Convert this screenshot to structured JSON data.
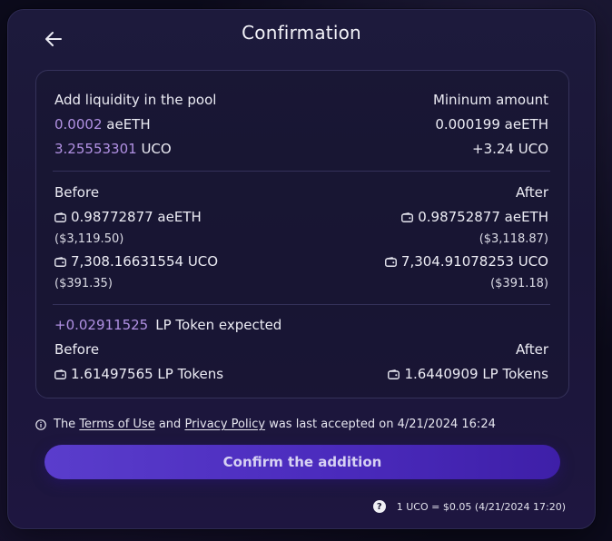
{
  "header": {
    "title": "Confirmation"
  },
  "summary": {
    "left_heading": "Add liquidity in the pool",
    "right_heading": "Mininum amount",
    "token1": {
      "amount": "0.0002",
      "symbol": "aeETH",
      "minimum": "0.000199 aeETH"
    },
    "token2": {
      "amount": "3.25553301",
      "symbol": "UCO",
      "minimum": "+3.24 UCO"
    }
  },
  "balances": {
    "before_label": "Before",
    "after_label": "After",
    "token1_before": "0.98772877 aeETH",
    "token1_before_usd": "($3,119.50)",
    "token1_after": "0.98752877 aeETH",
    "token1_after_usd": "($3,118.87)",
    "token2_before": "7,308.16631554 UCO",
    "token2_before_usd": "($391.35)",
    "token2_after": "7,304.91078253 UCO",
    "token2_after_usd": "($391.18)"
  },
  "lp": {
    "expected_amount": "+0.02911525",
    "expected_label": "LP Token expected",
    "before_label": "Before",
    "after_label": "After",
    "before_value": "1.61497565 LP Tokens",
    "after_value": "1.6440909 LP Tokens"
  },
  "terms": {
    "prefix": "The",
    "terms_link": "Terms of Use",
    "and": "and",
    "privacy_link": "Privacy Policy",
    "suffix": "was last accepted on 4/21/2024 16:24"
  },
  "confirm_label": "Confirm the addition",
  "rate": {
    "icon": "?",
    "text": "1 UCO = $0.05 (4/21/2024 17:20)"
  },
  "colors": {
    "accent": "#b191e3",
    "button": "#4b2bbd"
  }
}
